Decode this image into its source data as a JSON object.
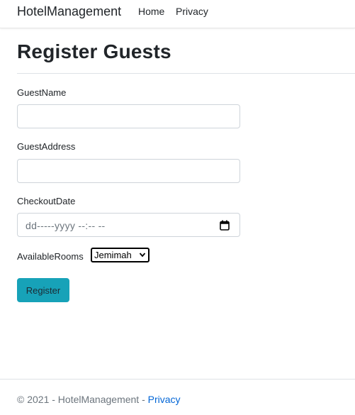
{
  "nav": {
    "brand": "HotelManagement",
    "links": [
      "Home",
      "Privacy"
    ]
  },
  "page": {
    "title": "Register Guests"
  },
  "form": {
    "guest_name": {
      "label": "GuestName",
      "value": ""
    },
    "guest_address": {
      "label": "GuestAddress",
      "value": ""
    },
    "checkout_date": {
      "label": "CheckoutDate",
      "placeholder": "dd-----yyyy --:-- --"
    },
    "available_rooms": {
      "label": "AvailableRooms",
      "selected": "Jemimah"
    },
    "submit_label": "Register"
  },
  "footer": {
    "text": "© 2021 - HotelManagement - ",
    "link": "Privacy"
  },
  "colors": {
    "button": "#17a2b8",
    "link": "#0366d6"
  }
}
